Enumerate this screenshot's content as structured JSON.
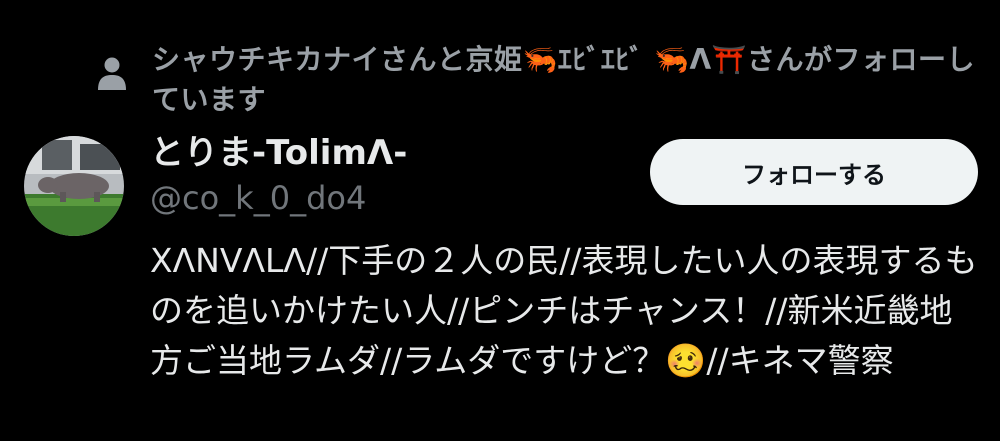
{
  "social_context": {
    "icon": "person-icon",
    "text": "シャウチキカナイさんと京姫🦐ｴﾋﾞｴﾋﾞ 🦐Λ⛩️さんがフォローしています"
  },
  "user": {
    "avatar": "avatar",
    "display_name": "とりま-TolimΛ-",
    "handle": "@co_k_0_do4",
    "bio": "XΛNVΛLΛ//下手の２人の民//表現したい人の表現するものを追いかけたい人//ピンチはチャンス！//新米近畿地方ご当地ラムダ//ラムダですけど？🥴//キネマ警察"
  },
  "follow_button": {
    "label": "フォローする"
  },
  "colors": {
    "background": "#000000",
    "primary_text": "#e7e9ea",
    "secondary_text": "#71767b",
    "button_bg": "#eff3f4",
    "button_text": "#0f1419"
  }
}
